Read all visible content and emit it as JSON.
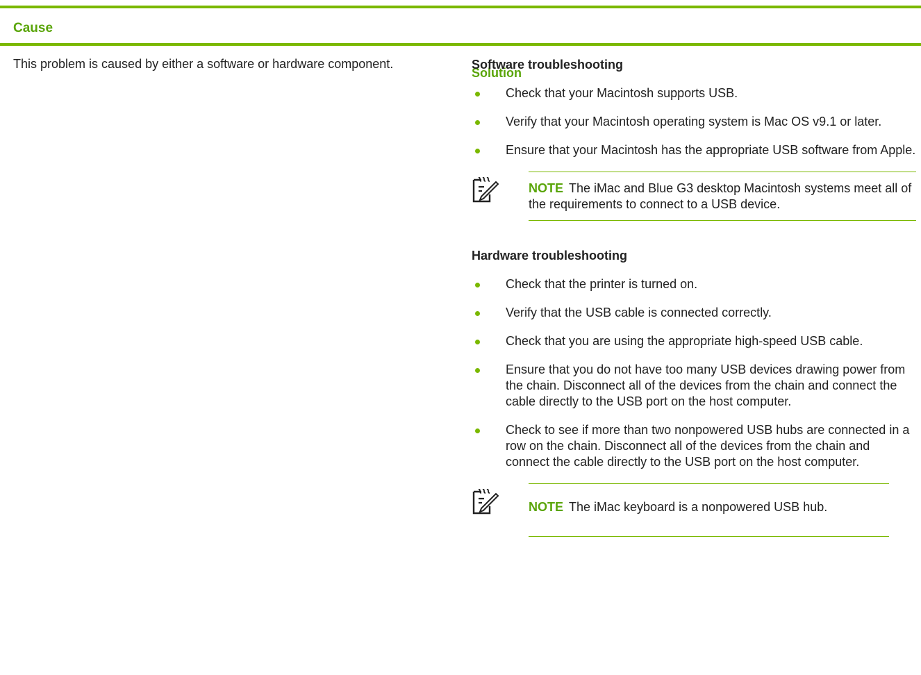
{
  "table": {
    "headers": {
      "cause": "Cause",
      "solution": "Solution"
    },
    "cause_text": "This problem is caused by either a software or hardware component.",
    "software": {
      "title": "Software troubleshooting",
      "items": [
        "Check that your Macintosh supports USB.",
        "Verify that your Macintosh operating system is Mac OS v9.1 or later.",
        "Ensure that your Macintosh has the appropriate USB software from Apple."
      ],
      "note": {
        "label": "NOTE",
        "text": "The iMac and Blue G3 desktop Macintosh systems meet all of the requirements to connect to a USB device."
      }
    },
    "hardware": {
      "title": "Hardware troubleshooting",
      "items": [
        "Check that the printer is turned on.",
        "Verify that the USB cable is connected correctly.",
        "Check that you are using the appropriate high-speed USB cable.",
        "Ensure that you do not have too many USB devices drawing power from the chain. Disconnect all of the devices from the chain and connect the cable directly to the USB port on the host computer.",
        "Check to see if more than two nonpowered USB hubs are connected in a row on the chain. Disconnect all of the devices from the chain and connect the cable directly to the USB port on the host computer."
      ],
      "note": {
        "label": "NOTE",
        "text": "The iMac keyboard is a nonpowered USB hub."
      }
    }
  },
  "colors": {
    "accent": "#7ab800",
    "heading": "#5aa50a"
  },
  "icons": {
    "note": "note-pencil-icon"
  }
}
